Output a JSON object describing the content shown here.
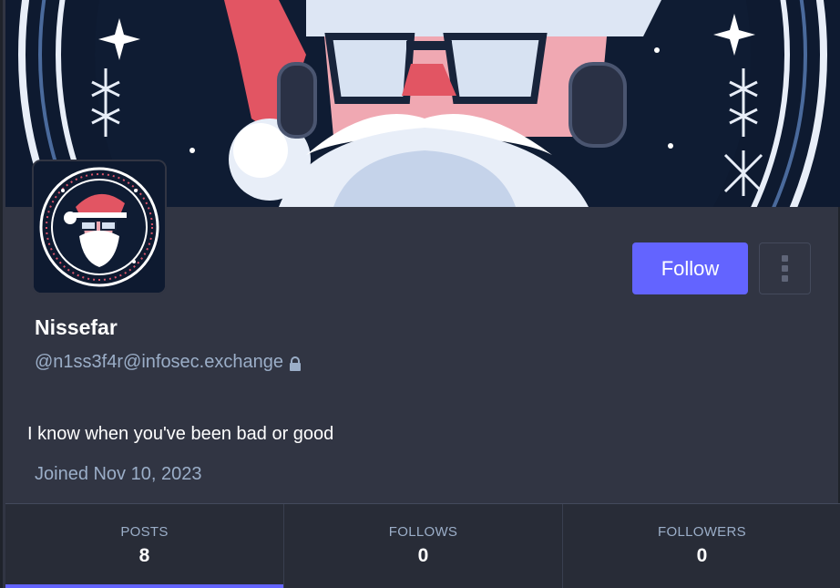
{
  "profile": {
    "display_name": "Nissefar",
    "handle": "@n1ss3f4r@infosec.exchange",
    "bio": "I know when you've been bad or good",
    "joined": "Joined Nov 10, 2023",
    "locked": true
  },
  "actions": {
    "follow_label": "Follow",
    "more_icon": "kebab-menu-icon"
  },
  "tabs": [
    {
      "label": "POSTS",
      "count": "8",
      "active": true
    },
    {
      "label": "FOLLOWS",
      "count": "0",
      "active": false
    },
    {
      "label": "FOLLOWERS",
      "count": "0",
      "active": false
    }
  ],
  "colors": {
    "accent": "#6364ff",
    "background": "#313543",
    "secondary_text": "#9baec8"
  }
}
